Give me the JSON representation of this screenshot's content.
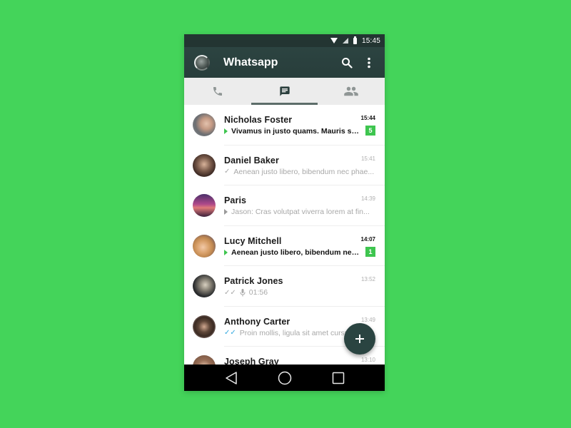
{
  "status_bar": {
    "time": "15:45",
    "icons": [
      "wifi-icon",
      "signal-icon",
      "battery-icon"
    ]
  },
  "app_bar": {
    "title": "Whatsapp",
    "actions": [
      "search-icon",
      "more-vert-icon"
    ]
  },
  "tabs": [
    {
      "name": "calls",
      "icon": "phone-icon",
      "active": false
    },
    {
      "name": "chats",
      "icon": "chat-icon",
      "active": true
    },
    {
      "name": "contacts",
      "icon": "group-icon",
      "active": false
    }
  ],
  "chats": [
    {
      "name": "Nicholas Foster",
      "time": "15:44",
      "preview": "Vivamus in justo quams. Mauris sit...",
      "status": "incoming",
      "unread": 5,
      "avatar_color": "#8a8f93"
    },
    {
      "name": "Daniel Baker",
      "time": "15:41",
      "preview": "Aenean justo libero, bibendum nec phae...",
      "status": "sent",
      "unread": null,
      "avatar_color": "#7a5b4b"
    },
    {
      "name": "Paris",
      "time": "14:39",
      "preview": "Jason: Cras volutpat viverra lorem at fin...",
      "status": "incoming-read",
      "unread": null,
      "avatar_color": "#7a3e6e"
    },
    {
      "name": "Lucy Mitchell",
      "time": "14:07",
      "preview": "Aenean justo libero, bibendum nece...",
      "status": "incoming",
      "unread": 1,
      "avatar_color": "#c89a6a"
    },
    {
      "name": "Patrick Jones",
      "time": "13:52",
      "preview": "01:56",
      "status": "delivered-voice",
      "unread": null,
      "avatar_color": "#3a3d3e"
    },
    {
      "name": "Anthony Carter",
      "time": "13:49",
      "preview": "Proin mollis, ligula sit amet cursus",
      "status": "read",
      "unread": null,
      "avatar_color": "#5e4638"
    },
    {
      "name": "Joseph Gray",
      "time": "13:10",
      "preview": "",
      "status": "",
      "unread": null,
      "avatar_color": "#9a7058"
    }
  ],
  "fab": {
    "label": "+",
    "icon": "add-icon"
  },
  "nav_bar": {
    "buttons": [
      "back-icon",
      "home-icon",
      "recents-icon"
    ]
  },
  "colors": {
    "background": "#44d45a",
    "app_bar": "#283d3b",
    "accent_green": "#3ec54f",
    "read_blue": "#34a9e0"
  }
}
